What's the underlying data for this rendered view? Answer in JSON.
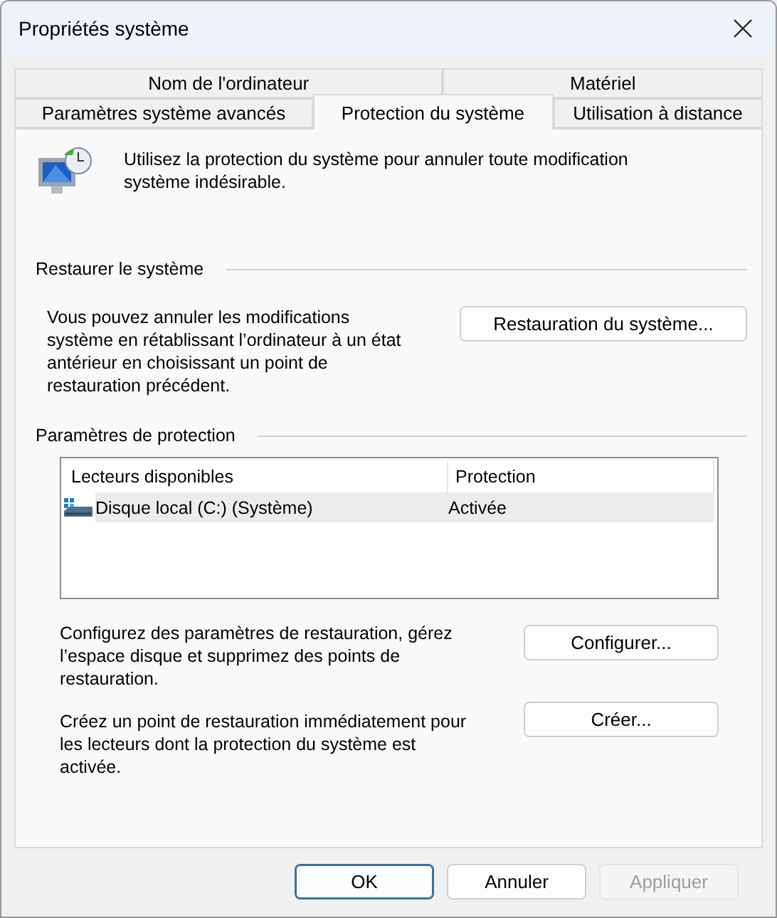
{
  "window": {
    "title": "Propriétés système"
  },
  "tab_rows": [
    [
      {
        "label": "Nom de l'ordinateur",
        "selected": false
      },
      {
        "label": "Matériel",
        "selected": false
      }
    ],
    [
      {
        "label": "Paramètres système avancés",
        "selected": false
      },
      {
        "label": "Protection du système",
        "selected": true
      },
      {
        "label": "Utilisation à distance",
        "selected": false
      }
    ]
  ],
  "intro": "Utilisez la protection du système pour annuler toute modification système indésirable.",
  "restore": {
    "heading": "Restaurer le système",
    "text": "Vous pouvez annuler les modifications système en rétablissant l’ordinateur à un état antérieur en choisissant un point de restauration précédent.",
    "button": "Restauration du système..."
  },
  "protection": {
    "heading": "Paramètres de protection",
    "columns": [
      "Lecteurs disponibles",
      "Protection"
    ],
    "rows": [
      {
        "drive": "Disque local (C:) (Système)",
        "protection": "Activée",
        "selected": true
      }
    ],
    "actions": [
      {
        "text": "Configurez des paramètres de restauration, gérez l’espace disque et supprimez des points de restauration.",
        "button": "Configurer..."
      },
      {
        "text": "Créez un point de restauration immédiatement pour les lecteurs dont la protection du système est activée.",
        "button": "Créer..."
      }
    ]
  },
  "buttons": [
    {
      "label": "OK",
      "kind": "default",
      "disabled": false
    },
    {
      "label": "Annuler",
      "kind": "normal",
      "disabled": false
    },
    {
      "label": "Appliquer",
      "kind": "normal",
      "disabled": true
    }
  ]
}
